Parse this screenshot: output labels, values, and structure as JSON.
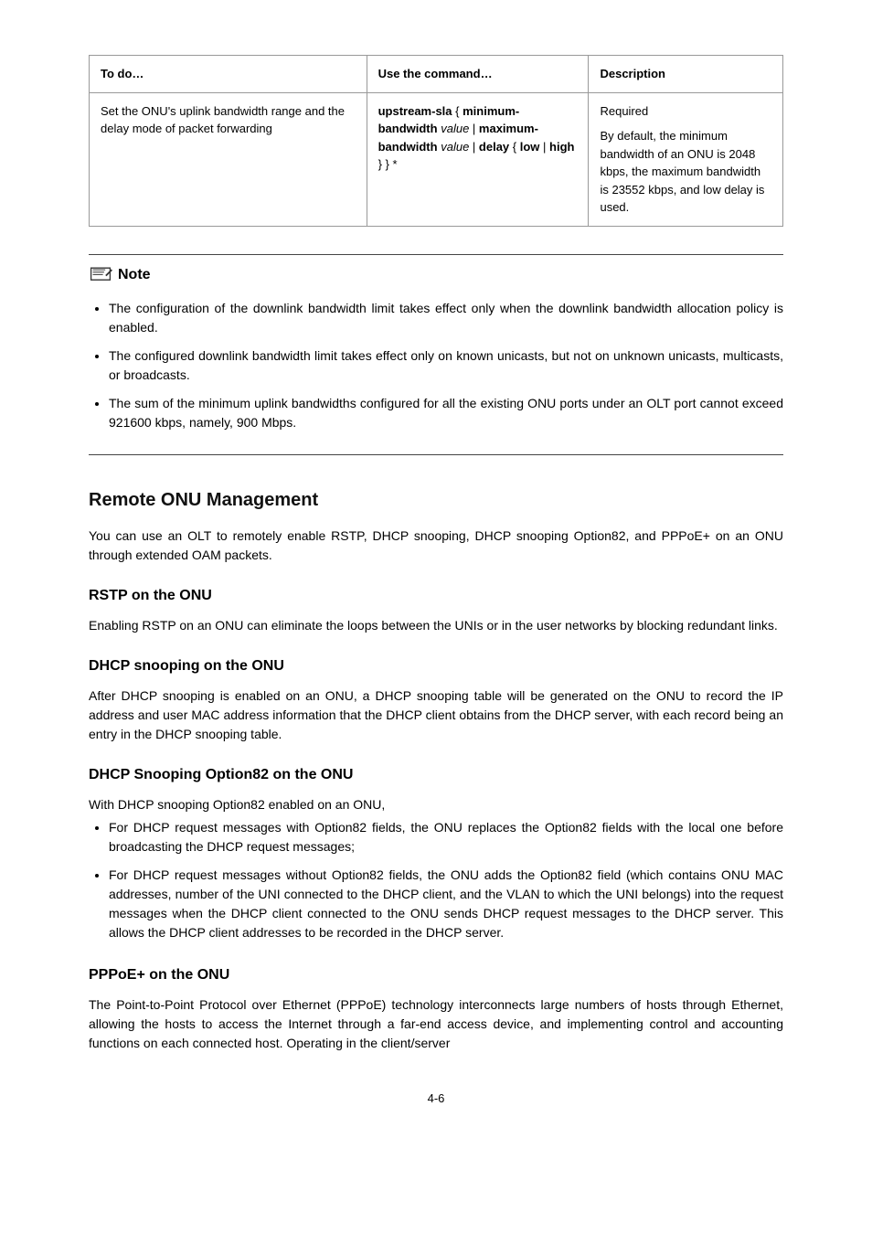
{
  "table": {
    "r1c1": "To do…",
    "r1c2": "Use the command…",
    "r1c3": "Description",
    "r2c1": "Set the ONU's uplink bandwidth range and the delay mode of packet forwarding",
    "r2c2": "upstream-sla { minimum-bandwidth value | maximum-bandwidth value | delay { low | high } } *",
    "r2c3_line1": "Required",
    "r2c3_line2": "By default, the minimum bandwidth of an ONU is 2048 kbps, the maximum bandwidth is 23552 kbps, and low delay is used."
  },
  "note": {
    "label": "Note",
    "items": [
      "The configuration of the downlink bandwidth limit takes effect only when the downlink bandwidth allocation policy is enabled.",
      "The configured downlink bandwidth limit takes effect only on known unicasts, but not on unknown unicasts, multicasts, or broadcasts.",
      "The sum of the minimum uplink bandwidths configured for all the existing ONU ports under an OLT port cannot exceed 921600 kbps, namely, 900 Mbps."
    ]
  },
  "section": {
    "title": "Remote ONU Management",
    "intro": "You can use an OLT to remotely enable RSTP, DHCP snooping, DHCP snooping Option82, and PPPoE+ on an ONU through extended OAM packets.",
    "rstp_title": "RSTP on the ONU",
    "rstp_body": "Enabling RSTP on an ONU can eliminate the loops between the UNIs or in the user networks by blocking redundant links.",
    "dhcp_title": "DHCP snooping on the ONU",
    "dhcp_body": "After DHCP snooping is enabled on an ONU, a DHCP snooping table will be generated on the ONU to record the IP address and user MAC address information that the DHCP client obtains from the DHCP server, with each record being an entry in the DHCP snooping table.",
    "opt_title": "DHCP Snooping Option82 on the ONU",
    "opt_intro": "With DHCP snooping Option82 enabled on an ONU,",
    "opt_items": [
      "For DHCP request messages with Option82 fields, the ONU replaces the Option82 fields with the local one before broadcasting the DHCP request messages;",
      "For DHCP request messages without Option82 fields, the ONU adds the Option82 field (which contains ONU MAC addresses, number of the UNI connected to the DHCP client, and the VLAN to which the UNI belongs) into the request messages when the DHCP client connected to the ONU sends DHCP request messages to the DHCP server. This allows the DHCP client addresses to be recorded in the DHCP server."
    ],
    "pppoe_title": "PPPoE+ on the ONU",
    "pppoe_body": "The Point-to-Point Protocol over Ethernet (PPPoE) technology interconnects large numbers of hosts through Ethernet, allowing the hosts to access the Internet through a far-end access device, and implementing control and accounting functions on each connected host. Operating in the client/server"
  },
  "pagenum": "4-6"
}
